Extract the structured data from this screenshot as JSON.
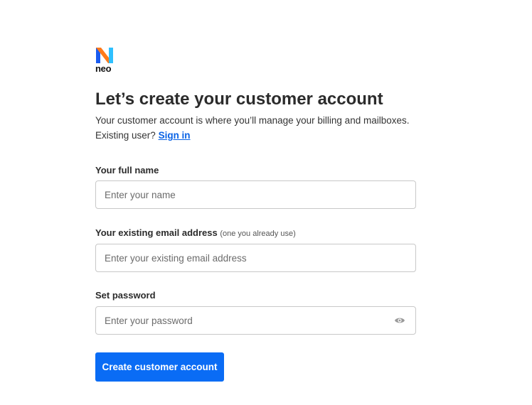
{
  "brand": {
    "name": "neo",
    "logo_icon": "neo-n-logo-icon",
    "colors": {
      "blue": "#1a5cf0",
      "orange": "#ff7a1a",
      "cyan": "#2ec0ff"
    }
  },
  "header": {
    "title": "Let’s create your customer account",
    "subtitle": "Your customer account is where you’ll manage your billing and mailboxes.",
    "existing_prefix": "Existing user?",
    "signin_link": "Sign in"
  },
  "form": {
    "name": {
      "label": "Your full name",
      "placeholder": "Enter your name",
      "value": ""
    },
    "email": {
      "label": "Your existing email address",
      "hint": "(one you already use)",
      "placeholder": "Enter your existing email address",
      "value": ""
    },
    "password": {
      "label": "Set password",
      "placeholder": "Enter your password",
      "value": "",
      "toggle_icon": "eye-icon"
    },
    "submit_label": "Create customer account"
  },
  "colors": {
    "accent": "#0a6cf5",
    "link": "#0a63e6",
    "border": "#c8c8c8"
  }
}
